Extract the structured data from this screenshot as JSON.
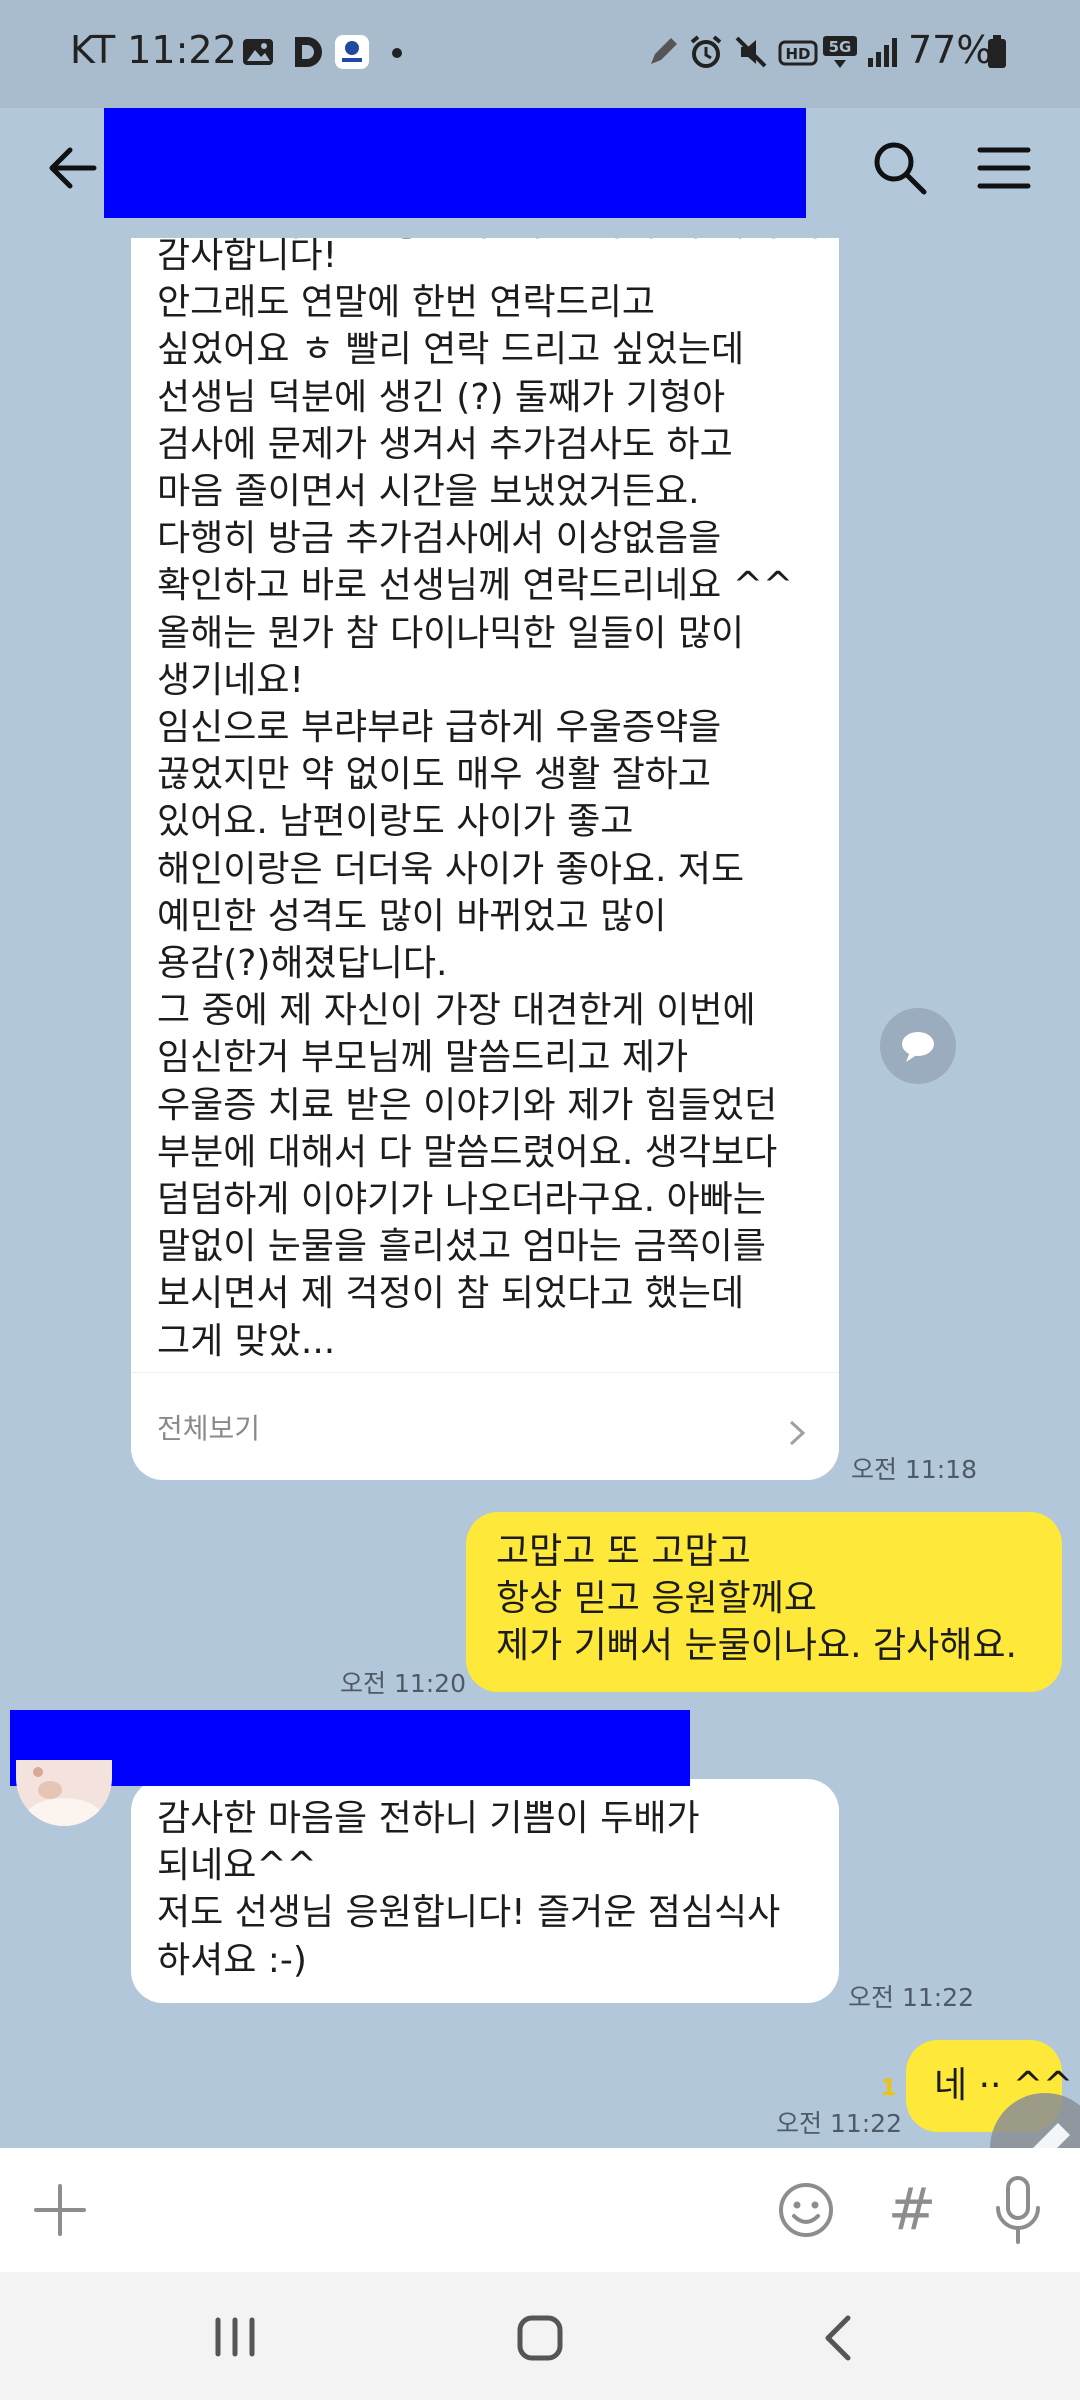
{
  "status_bar": {
    "carrier_time": "KT 11:22",
    "battery": "77%"
  },
  "header": {
    "icons": [
      "back-arrow-icon",
      "search-icon",
      "menu-icon"
    ]
  },
  "messages": {
    "long_message": {
      "lines": [
        "감사합니다!",
        "안그래도 연말에 한번 연락드리고",
        "싶었어요 ㅎ 빨리 연락 드리고 싶었는데",
        "선생님 덕분에 생긴 (?) 둘째가 기형아",
        "검사에 문제가 생겨서 추가검사도 하고",
        "마음 졸이면서 시간을 보냈었거든요.",
        "다행히 방금 추가검사에서 이상없음을",
        "확인하고 바로 선생님께 연락드리네요 ^^",
        "올해는 뭔가 참 다이나믹한 일들이 많이",
        "생기네요!",
        "임신으로 부랴부랴 급하게 우울증약을",
        "끊었지만 약 없이도 매우 생활 잘하고",
        "있어요. 남편이랑도 사이가 좋고",
        "해인이랑은 더더욱 사이가 좋아요. 저도",
        "예민한 성격도 많이 바뀌었고 많이",
        "용감(?)해졌답니다.",
        "그 중에 제 자신이 가장 대견한게 이번에",
        "임신한거 부모님께 말씀드리고 제가",
        "우울증 치료 받은 이야기와 제가 힘들었던",
        "부분에 대해서 다 말씀드렸어요. 생각보다",
        "덤덤하게 이야기가 나오더라구요. 아빠는",
        "말없이 눈물을 흘리셨고 엄마는 금쪽이를",
        "보시면서 제 걱정이 참 되었다고 했는데",
        "그게 맞았..."
      ],
      "see_all": "전체보기",
      "time": "오전 11:18"
    },
    "reply_1": {
      "lines": [
        "고맙고 또 고맙고",
        "항상 믿고 응원할께요",
        "제가 기뻐서 눈물이나요. 감사해요."
      ],
      "time": "오전 11:20"
    },
    "received_2": {
      "lines": [
        "감사한 마음을 전하니 기쁨이 두배가",
        "되네요^^",
        "저도 선생님 응원합니다! 즐거운 점심식사",
        "하셔요 :-)"
      ],
      "time": "오전 11:22"
    },
    "reply_2": {
      "text": "네 ·· ^^",
      "unread": "1",
      "time": "오전 11:22"
    }
  },
  "input_bar": {
    "hash": "#",
    "icons": [
      "plus-icon",
      "emoji-icon",
      "hash-icon",
      "mic-icon"
    ]
  },
  "nav_bar": {
    "icons": [
      "recent-apps-icon",
      "home-icon",
      "back-icon"
    ]
  }
}
